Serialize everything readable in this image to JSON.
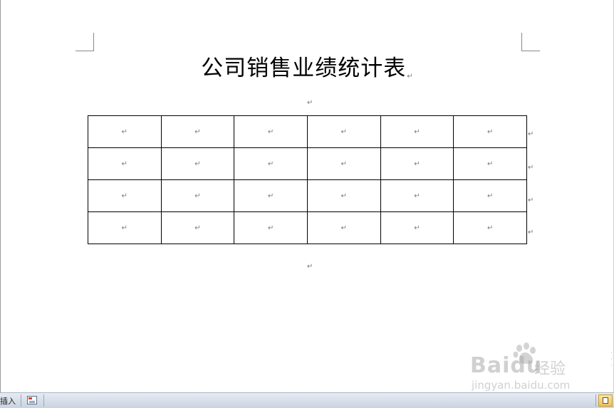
{
  "document": {
    "title": "公司销售业绩统计表",
    "paragraph_mark": "↵",
    "table": {
      "rows": 4,
      "cols": 6,
      "cells": [
        [
          "↵",
          "↵",
          "↵",
          "↵",
          "↵",
          "↵"
        ],
        [
          "↵",
          "↵",
          "↵",
          "↵",
          "↵",
          "↵"
        ],
        [
          "↵",
          "↵",
          "↵",
          "↵",
          "↵",
          "↵"
        ],
        [
          "↵",
          "↵",
          "↵",
          "↵",
          "↵",
          "↵"
        ]
      ]
    }
  },
  "statusbar": {
    "mode_label": "插入",
    "macro_icon": "macro-record-icon",
    "view_icon": "page-view-icon"
  },
  "watermark": {
    "brand": "Baidu",
    "product": "经验",
    "url": "jingyan.baidu.com",
    "icon": "baidu-paw-icon"
  }
}
